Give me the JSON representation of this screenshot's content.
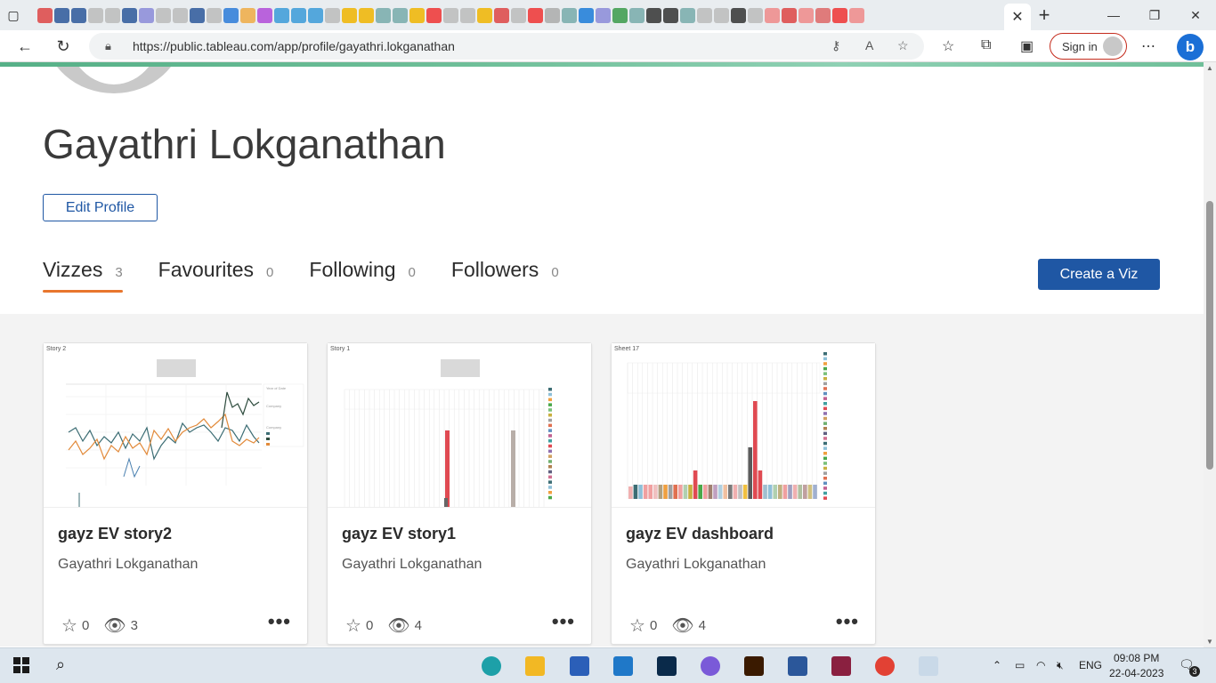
{
  "browser": {
    "url": "https://public.tableau.com/app/profile/gayathri.lokganathan",
    "signin_label": "Sign in",
    "tab_close": "✕",
    "new_tab": "+"
  },
  "profile": {
    "name": "Gayathri Lokganathan",
    "edit_label": "Edit Profile",
    "create_label": "Create a Viz",
    "tabs": [
      {
        "label": "Vizzes",
        "count": "3"
      },
      {
        "label": "Favourites",
        "count": "0"
      },
      {
        "label": "Following",
        "count": "0"
      },
      {
        "label": "Followers",
        "count": "0"
      }
    ]
  },
  "vizzes": [
    {
      "thumb_title": "Story 2",
      "title": "gayz EV story2",
      "author": "Gayathri Lokganathan",
      "favorites": "0",
      "views": "3"
    },
    {
      "thumb_title": "Story 1",
      "title": "gayz EV story1",
      "author": "Gayathri Lokganathan",
      "favorites": "0",
      "views": "4"
    },
    {
      "thumb_title": "Sheet 17",
      "title": "gayz EV dashboard",
      "author": "Gayathri Lokganathan",
      "favorites": "0",
      "views": "4"
    }
  ],
  "taskbar": {
    "language": "ENG",
    "time": "09:08 PM",
    "date": "22-04-2023",
    "notifications": "3"
  }
}
